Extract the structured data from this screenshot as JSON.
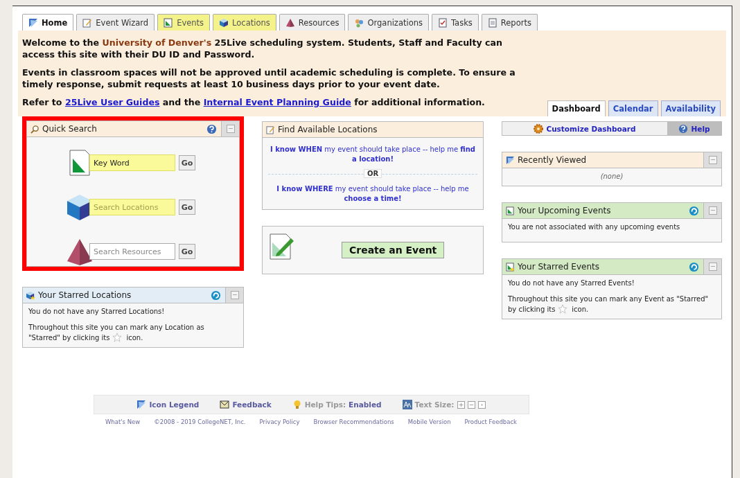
{
  "tabs": [
    {
      "label": "Home",
      "selected": true,
      "highlighted": false
    },
    {
      "label": "Event Wizard",
      "selected": false,
      "highlighted": false
    },
    {
      "label": "Events",
      "selected": false,
      "highlighted": true
    },
    {
      "label": "Locations",
      "selected": false,
      "highlighted": true
    },
    {
      "label": "Resources",
      "selected": false,
      "highlighted": false
    },
    {
      "label": "Organizations",
      "selected": false,
      "highlighted": false
    },
    {
      "label": "Tasks",
      "selected": false,
      "highlighted": false
    },
    {
      "label": "Reports",
      "selected": false,
      "highlighted": false
    }
  ],
  "banner": {
    "paragraphs": [
      [
        {
          "kind": "text",
          "text": "Welcome to the "
        },
        {
          "kind": "accent",
          "text": "University of Denver's"
        },
        {
          "kind": "text",
          "text": " 25Live scheduling system. Students, Staff and Faculty can access this site with their DU ID and Password."
        }
      ],
      [
        {
          "kind": "text",
          "text": "Events in classroom spaces will not be approved until academic scheduling is complete. To ensure a timely response, submit requests at least 10 business days prior to your event date."
        }
      ],
      [
        {
          "kind": "text",
          "text": "Refer to "
        },
        {
          "kind": "link",
          "text": "25Live User Guides"
        },
        {
          "kind": "text",
          "text": " and the "
        },
        {
          "kind": "link",
          "text": "Internal Event Planning Guide"
        },
        {
          "kind": "text",
          "text": " for additional information."
        }
      ]
    ],
    "view_tabs": [
      {
        "label": "Dashboard",
        "selected": true
      },
      {
        "label": "Calendar",
        "selected": false
      },
      {
        "label": "Availability",
        "selected": false
      }
    ]
  },
  "quick_search": {
    "title": "Quick Search",
    "highlighted": true,
    "fields": [
      {
        "value": "Key Word",
        "highlighted": true,
        "button": "Go"
      },
      {
        "placeholder": "Search Locations",
        "highlighted": true,
        "button": "Go"
      },
      {
        "placeholder": "Search Resources",
        "highlighted": false,
        "button": "Go"
      }
    ]
  },
  "starred_locations": {
    "title": "Your Starred Locations",
    "message": "You do not have any Starred Locations!",
    "hint_before": [
      "Throughout this site you can mark any Location as",
      "\"Starred\" by clicking its"
    ],
    "hint_after": "icon."
  },
  "find_locations": {
    "title": "Find Available Locations",
    "options": [
      "**I know WHEN** my event should take place -- help me **find a location!**",
      "**I know WHERE** my event should take place -- help me **choose a time!**"
    ],
    "separator": "OR"
  },
  "create_event": {
    "button": "Create an Event"
  },
  "customize": {
    "label": "Customize Dashboard",
    "help": "Help"
  },
  "right_panels": [
    {
      "title": "Recently Viewed",
      "color": "#fbeedd",
      "refresh": false,
      "empty": "(none)"
    },
    {
      "title": "Your Upcoming Events",
      "color": "#d4eac4",
      "refresh": true,
      "message": "You are not associated with any upcoming events"
    },
    {
      "title": "Your Starred Events",
      "color": "#d4eac4",
      "refresh": true,
      "message": "You do not have any Starred Events!",
      "hint_before": [
        "Throughout this site you can mark any Event as \"Starred\"",
        "by clicking its"
      ],
      "hint_after": "icon."
    }
  ],
  "footer": {
    "tools": [
      {
        "kind": "legend",
        "label": "Icon Legend"
      },
      {
        "kind": "feedback",
        "label": "Feedback"
      },
      {
        "kind": "tips",
        "label": "Help Tips:",
        "value": "Enabled"
      },
      {
        "kind": "size",
        "label": "Text Size:"
      }
    ],
    "links": [
      "What's New",
      "©2008 - 2019 CollegeNET, Inc.",
      "Privacy Policy",
      "Browser Recommendations",
      "Mobile Version",
      "Product Feedback"
    ]
  }
}
